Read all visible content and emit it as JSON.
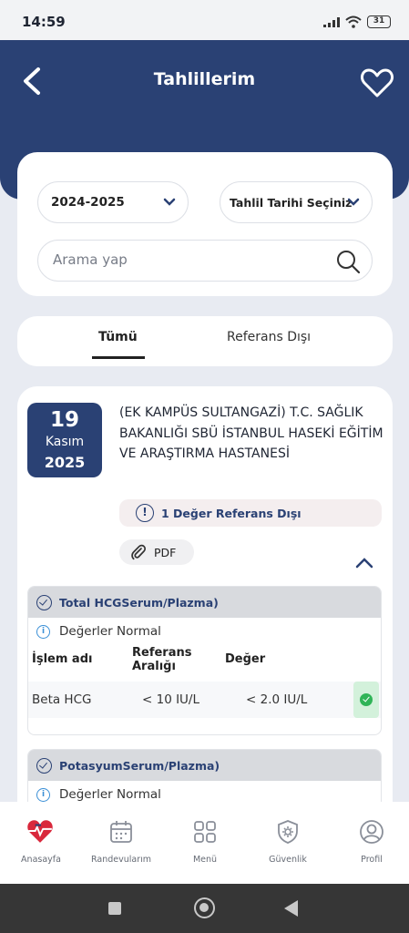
{
  "status_bar": {
    "time": "14:59",
    "battery": "31"
  },
  "header": {
    "title": "Tahlillerim"
  },
  "filters": {
    "year_value": "2024-2025",
    "date_value": "Tahlil Tarihi Seçiniz",
    "search_placeholder": "Arama yap"
  },
  "tabs": [
    {
      "label": "Tümü",
      "active": true
    },
    {
      "label": "Referans Dışı",
      "active": false
    }
  ],
  "result": {
    "date": {
      "day": "19",
      "month": "Kasım",
      "year": "2025"
    },
    "hospital": "(EK KAMPÜS SULTANGAZİ) T.C. SAĞLIK BAKANLIĞI SBÜ İSTANBUL HASEKİ EĞİTİM VE ARAŞTIRMA HASTANESİ",
    "reference_warning": "1 Değer Referans Dışı",
    "pdf_label": "PDF",
    "tests": [
      {
        "name": "Total HCGSerum/Plazma)",
        "status": "Değerler Normal",
        "columns": {
          "name": "İşlem adı",
          "ref": "Referans Aralığı",
          "value": "Değer"
        },
        "rows": [
          {
            "name": "Beta HCG",
            "ref": "< 10 IU/L",
            "value": "< 2.0 IU/L",
            "status": "normal"
          }
        ]
      },
      {
        "name": "PotasyumSerum/Plazma)",
        "status": "Değerler Normal"
      }
    ]
  },
  "bottom_nav": [
    {
      "label": "Anasayfa",
      "icon": "heart-health-icon",
      "active": true
    },
    {
      "label": "Randevularım",
      "icon": "calendar-icon"
    },
    {
      "label": "Menü",
      "icon": "grid-icon"
    },
    {
      "label": "Güvenlik",
      "icon": "shield-gear-icon"
    },
    {
      "label": "Profil",
      "icon": "user-icon"
    }
  ],
  "colors": {
    "primary": "#2a4174",
    "success": "#2fb457",
    "accent": "#d9283c"
  }
}
